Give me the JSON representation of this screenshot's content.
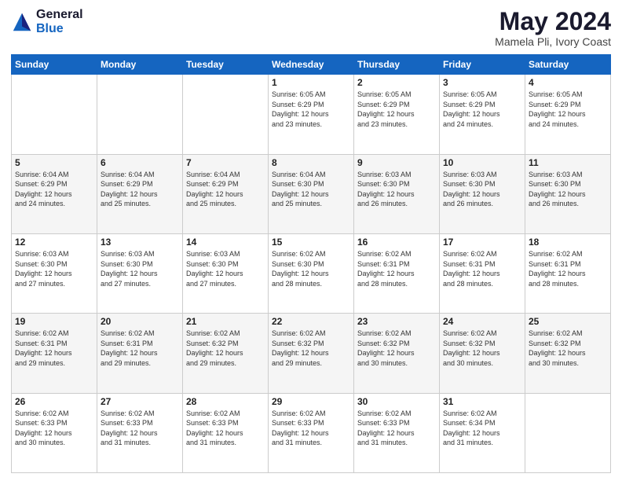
{
  "header": {
    "logo_general": "General",
    "logo_blue": "Blue",
    "month_year": "May 2024",
    "location": "Mamela Pli, Ivory Coast"
  },
  "calendar": {
    "days_of_week": [
      "Sunday",
      "Monday",
      "Tuesday",
      "Wednesday",
      "Thursday",
      "Friday",
      "Saturday"
    ],
    "weeks": [
      [
        {
          "day": "",
          "info": ""
        },
        {
          "day": "",
          "info": ""
        },
        {
          "day": "",
          "info": ""
        },
        {
          "day": "1",
          "info": "Sunrise: 6:05 AM\nSunset: 6:29 PM\nDaylight: 12 hours\nand 23 minutes."
        },
        {
          "day": "2",
          "info": "Sunrise: 6:05 AM\nSunset: 6:29 PM\nDaylight: 12 hours\nand 23 minutes."
        },
        {
          "day": "3",
          "info": "Sunrise: 6:05 AM\nSunset: 6:29 PM\nDaylight: 12 hours\nand 24 minutes."
        },
        {
          "day": "4",
          "info": "Sunrise: 6:05 AM\nSunset: 6:29 PM\nDaylight: 12 hours\nand 24 minutes."
        }
      ],
      [
        {
          "day": "5",
          "info": "Sunrise: 6:04 AM\nSunset: 6:29 PM\nDaylight: 12 hours\nand 24 minutes."
        },
        {
          "day": "6",
          "info": "Sunrise: 6:04 AM\nSunset: 6:29 PM\nDaylight: 12 hours\nand 25 minutes."
        },
        {
          "day": "7",
          "info": "Sunrise: 6:04 AM\nSunset: 6:29 PM\nDaylight: 12 hours\nand 25 minutes."
        },
        {
          "day": "8",
          "info": "Sunrise: 6:04 AM\nSunset: 6:30 PM\nDaylight: 12 hours\nand 25 minutes."
        },
        {
          "day": "9",
          "info": "Sunrise: 6:03 AM\nSunset: 6:30 PM\nDaylight: 12 hours\nand 26 minutes."
        },
        {
          "day": "10",
          "info": "Sunrise: 6:03 AM\nSunset: 6:30 PM\nDaylight: 12 hours\nand 26 minutes."
        },
        {
          "day": "11",
          "info": "Sunrise: 6:03 AM\nSunset: 6:30 PM\nDaylight: 12 hours\nand 26 minutes."
        }
      ],
      [
        {
          "day": "12",
          "info": "Sunrise: 6:03 AM\nSunset: 6:30 PM\nDaylight: 12 hours\nand 27 minutes."
        },
        {
          "day": "13",
          "info": "Sunrise: 6:03 AM\nSunset: 6:30 PM\nDaylight: 12 hours\nand 27 minutes."
        },
        {
          "day": "14",
          "info": "Sunrise: 6:03 AM\nSunset: 6:30 PM\nDaylight: 12 hours\nand 27 minutes."
        },
        {
          "day": "15",
          "info": "Sunrise: 6:02 AM\nSunset: 6:30 PM\nDaylight: 12 hours\nand 28 minutes."
        },
        {
          "day": "16",
          "info": "Sunrise: 6:02 AM\nSunset: 6:31 PM\nDaylight: 12 hours\nand 28 minutes."
        },
        {
          "day": "17",
          "info": "Sunrise: 6:02 AM\nSunset: 6:31 PM\nDaylight: 12 hours\nand 28 minutes."
        },
        {
          "day": "18",
          "info": "Sunrise: 6:02 AM\nSunset: 6:31 PM\nDaylight: 12 hours\nand 28 minutes."
        }
      ],
      [
        {
          "day": "19",
          "info": "Sunrise: 6:02 AM\nSunset: 6:31 PM\nDaylight: 12 hours\nand 29 minutes."
        },
        {
          "day": "20",
          "info": "Sunrise: 6:02 AM\nSunset: 6:31 PM\nDaylight: 12 hours\nand 29 minutes."
        },
        {
          "day": "21",
          "info": "Sunrise: 6:02 AM\nSunset: 6:32 PM\nDaylight: 12 hours\nand 29 minutes."
        },
        {
          "day": "22",
          "info": "Sunrise: 6:02 AM\nSunset: 6:32 PM\nDaylight: 12 hours\nand 29 minutes."
        },
        {
          "day": "23",
          "info": "Sunrise: 6:02 AM\nSunset: 6:32 PM\nDaylight: 12 hours\nand 30 minutes."
        },
        {
          "day": "24",
          "info": "Sunrise: 6:02 AM\nSunset: 6:32 PM\nDaylight: 12 hours\nand 30 minutes."
        },
        {
          "day": "25",
          "info": "Sunrise: 6:02 AM\nSunset: 6:32 PM\nDaylight: 12 hours\nand 30 minutes."
        }
      ],
      [
        {
          "day": "26",
          "info": "Sunrise: 6:02 AM\nSunset: 6:33 PM\nDaylight: 12 hours\nand 30 minutes."
        },
        {
          "day": "27",
          "info": "Sunrise: 6:02 AM\nSunset: 6:33 PM\nDaylight: 12 hours\nand 31 minutes."
        },
        {
          "day": "28",
          "info": "Sunrise: 6:02 AM\nSunset: 6:33 PM\nDaylight: 12 hours\nand 31 minutes."
        },
        {
          "day": "29",
          "info": "Sunrise: 6:02 AM\nSunset: 6:33 PM\nDaylight: 12 hours\nand 31 minutes."
        },
        {
          "day": "30",
          "info": "Sunrise: 6:02 AM\nSunset: 6:33 PM\nDaylight: 12 hours\nand 31 minutes."
        },
        {
          "day": "31",
          "info": "Sunrise: 6:02 AM\nSunset: 6:34 PM\nDaylight: 12 hours\nand 31 minutes."
        },
        {
          "day": "",
          "info": ""
        }
      ]
    ]
  }
}
